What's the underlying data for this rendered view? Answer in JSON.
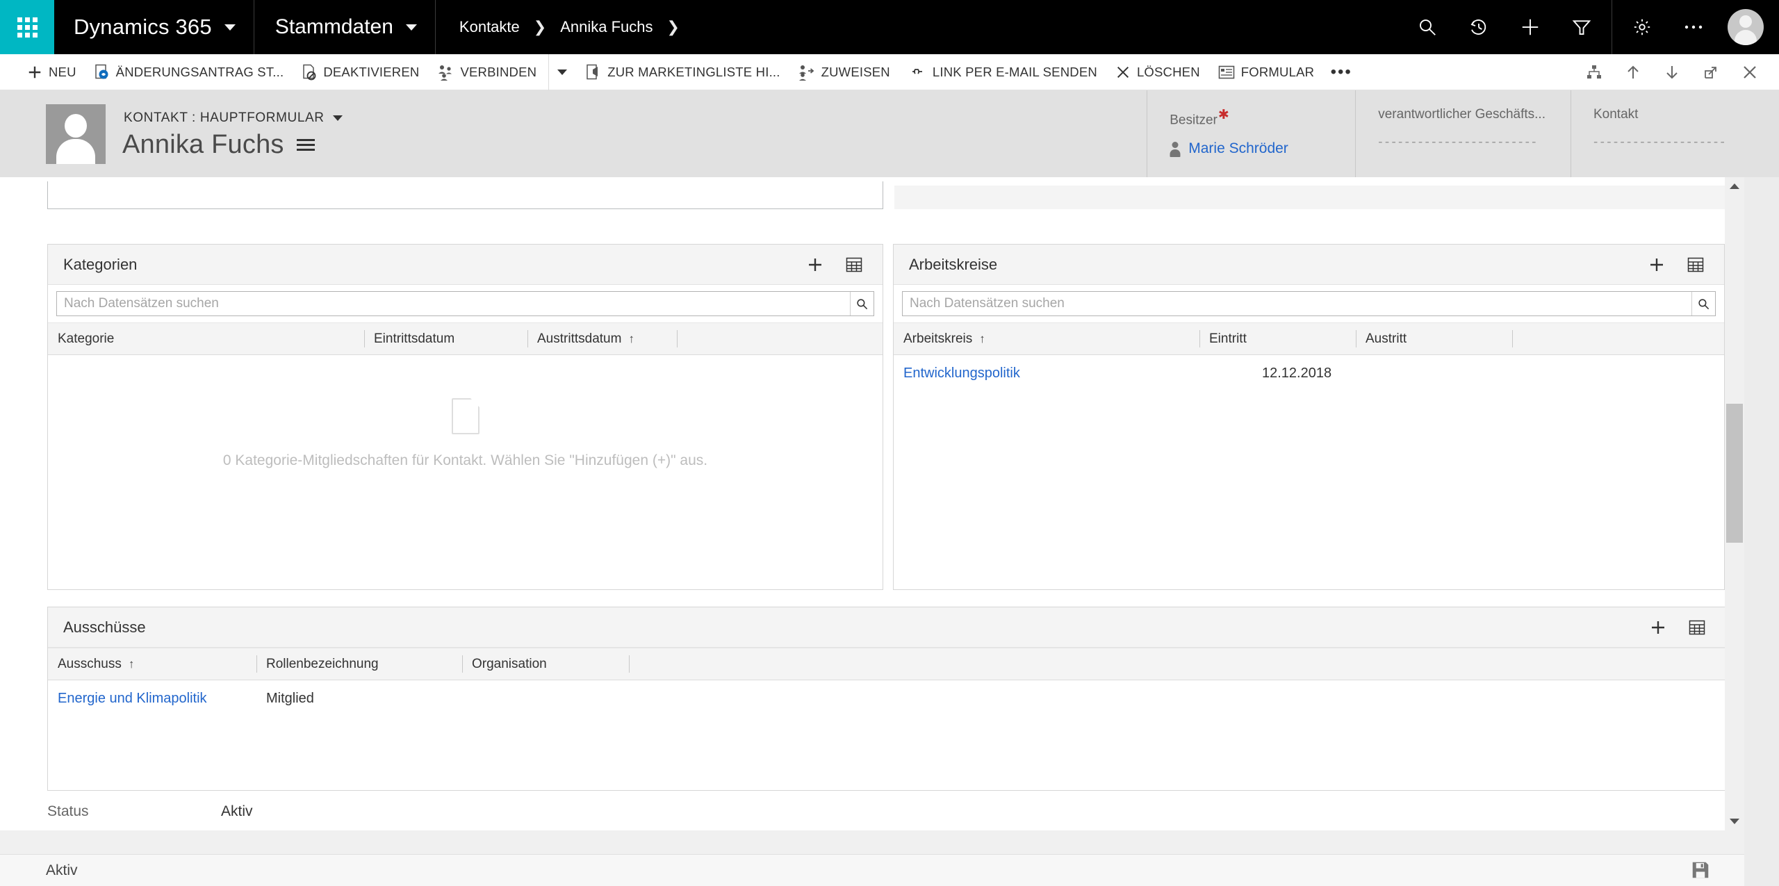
{
  "topbar": {
    "waffle_label": "app-launcher",
    "brand": "Dynamics 365",
    "area": "Stammdaten",
    "breadcrumb": [
      {
        "label": "Kontakte"
      },
      {
        "label": "Annika Fuchs"
      }
    ],
    "icons": [
      {
        "name": "search-icon"
      },
      {
        "name": "history-icon"
      },
      {
        "name": "quick-create-icon"
      },
      {
        "name": "filter-icon"
      },
      {
        "name": "settings-gear-icon"
      },
      {
        "name": "more-icon"
      }
    ]
  },
  "commandbar": {
    "items": [
      {
        "id": "neu",
        "label": "NEU",
        "icon": "plus-icon"
      },
      {
        "id": "aenderungsantrag",
        "label": "ÄNDERUNGSANTRAG ST...",
        "icon": "request-icon"
      },
      {
        "id": "deaktivieren",
        "label": "DEAKTIVIEREN",
        "icon": "deactivate-icon"
      },
      {
        "id": "verbinden",
        "label": "VERBINDEN",
        "icon": "connect-icon"
      },
      {
        "id": "marketingliste",
        "label": "ZUR MARKETINGLISTE HI...",
        "icon": "marketing-list-icon"
      },
      {
        "id": "zuweisen",
        "label": "ZUWEISEN",
        "icon": "assign-icon"
      },
      {
        "id": "link_email",
        "label": "LINK PER E-MAIL SENDEN",
        "icon": "link-email-icon"
      },
      {
        "id": "loeschen",
        "label": "LÖSCHEN",
        "icon": "delete-icon"
      },
      {
        "id": "formular",
        "label": "FORMULAR",
        "icon": "form-icon"
      }
    ],
    "overflow_label": "•••",
    "right_icons": [
      {
        "name": "hierarchy-icon"
      },
      {
        "name": "arrow-up-icon"
      },
      {
        "name": "arrow-down-icon"
      },
      {
        "name": "popout-icon"
      },
      {
        "name": "close-icon"
      }
    ]
  },
  "record_header": {
    "form_selector": "KONTAKT : HAUPTFORMULAR",
    "record_name": "Annika Fuchs",
    "fields": [
      {
        "label": "Besitzer",
        "required": true,
        "value": "Marie Schröder",
        "type": "lookup"
      },
      {
        "label": "verantwortlicher Geschäfts...",
        "required": false,
        "value": "- - - - - - - - - - - - - - - - - - - - - - - -",
        "type": "empty"
      },
      {
        "label": "Kontakt",
        "required": false,
        "value": "- - - - - - - - - - - - - - - - - - - -",
        "type": "empty"
      }
    ]
  },
  "panels": {
    "kategorien": {
      "title": "Kategorien",
      "search_placeholder": "Nach Datensätzen suchen",
      "search_value": "",
      "columns": [
        {
          "label": "Kategorie",
          "sort": ""
        },
        {
          "label": "Eintrittsdatum",
          "sort": ""
        },
        {
          "label": "Austrittsdatum",
          "sort": "↑"
        },
        {
          "label": "",
          "sort": ""
        }
      ],
      "rows": [],
      "empty_message": "0 Kategorie-Mitgliedschaften für Kontakt. Wählen Sie \"Hinzufügen (+)\" aus.",
      "actions": [
        {
          "name": "add-record-button",
          "glyph": "+"
        },
        {
          "name": "open-grid-button",
          "glyph": "grid"
        }
      ]
    },
    "arbeitskreise": {
      "title": "Arbeitskreise",
      "search_placeholder": "Nach Datensätzen suchen",
      "search_value": "",
      "columns": [
        {
          "label": "Arbeitskreis",
          "sort": "↑"
        },
        {
          "label": "Eintritt",
          "sort": ""
        },
        {
          "label": "Austritt",
          "sort": ""
        },
        {
          "label": "",
          "sort": ""
        }
      ],
      "rows": [
        {
          "arbeitskreis": "Entwicklungspolitik",
          "eintritt": "12.12.2018",
          "austritt": ""
        }
      ],
      "actions": [
        {
          "name": "add-record-button",
          "glyph": "+"
        },
        {
          "name": "open-grid-button",
          "glyph": "grid"
        }
      ]
    },
    "ausschuesse": {
      "title": "Ausschüsse",
      "columns": [
        {
          "label": "Ausschuss",
          "sort": "↑"
        },
        {
          "label": "Rollenbezeichnung",
          "sort": ""
        },
        {
          "label": "Organisation",
          "sort": ""
        },
        {
          "label": "",
          "sort": ""
        }
      ],
      "rows": [
        {
          "ausschuss": "Energie und Klimapolitik",
          "rolle": "Mitglied",
          "organisation": ""
        }
      ],
      "actions": [
        {
          "name": "add-record-button",
          "glyph": "+"
        },
        {
          "name": "open-grid-button",
          "glyph": "grid"
        }
      ]
    }
  },
  "status_field": {
    "label": "Status",
    "value": "Aktiv"
  },
  "footer": {
    "status_text": "Aktiv",
    "save_icon": "save-icon"
  },
  "colors": {
    "accent_teal": "#00B7C3",
    "topbar_black": "#000000",
    "link_blue": "#2266cc",
    "header_grey": "#e1e1e1",
    "required_red": "#c72c2c"
  }
}
